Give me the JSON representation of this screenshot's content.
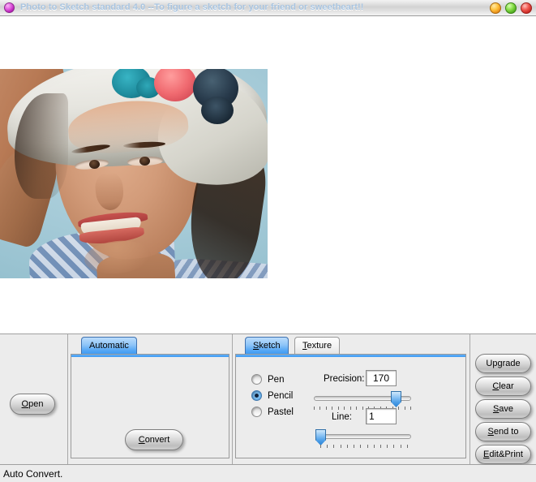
{
  "window": {
    "title": "Photo to Sketch standard 4.0 --To figure a sketch for your friend or sweetheart!!",
    "icon": "app-circle-icon",
    "buttons": {
      "minimize": "minimize-icon",
      "maximize": "maximize-icon",
      "close": "close-icon"
    },
    "colors": {
      "title_text": "#a8c4e0",
      "minimize": "#ffc23b",
      "maximize": "#86dd46",
      "close": "#f0564e",
      "accent_blue": "#3f9bf3",
      "panel_bg": "#ececec"
    }
  },
  "canvas": {
    "photo_alt": "portrait-photo-woman-with-flower-hat"
  },
  "open_panel": {
    "open_label": "Open",
    "open_accel": "O"
  },
  "automatic_panel": {
    "tabs": [
      {
        "label": "Automatic",
        "accel": "",
        "active": true
      }
    ],
    "convert_label": "Convert",
    "convert_accel": "C"
  },
  "sketch_panel": {
    "tabs": [
      {
        "label": "Sketch",
        "accel": "S",
        "active": true
      },
      {
        "label": "Texture",
        "accel": "T",
        "active": false
      }
    ],
    "styles": [
      {
        "label": "Pen",
        "selected": false
      },
      {
        "label": "Pencil",
        "selected": true
      },
      {
        "label": "Pastel",
        "selected": false
      }
    ],
    "precision": {
      "label": "Precision:",
      "value": "170",
      "slider_percent": 85,
      "ticks": 17
    },
    "line": {
      "label": "Line:",
      "value": "1",
      "slider_percent": 2,
      "ticks": 14
    }
  },
  "action_buttons": [
    {
      "label": "Upgrade",
      "accel": ""
    },
    {
      "label": "Clear",
      "accel": "C"
    },
    {
      "label": "Save",
      "accel": "S"
    },
    {
      "label": "Send to",
      "accel": "S"
    },
    {
      "label": "Edit&Print",
      "accel": "E"
    }
  ],
  "statusbar": {
    "text": "Auto Convert."
  }
}
